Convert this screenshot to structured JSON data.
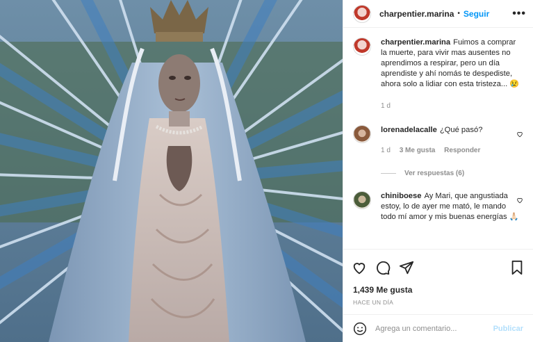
{
  "post": {
    "author": "charpentier.marina",
    "follow_label": "Seguir",
    "separator": "•",
    "more_label": "•••"
  },
  "caption": {
    "username": "charpentier.marina",
    "text": "Fuimos a comprar la muerte, para vivir mas ausentes no aprendimos a respirar, pero un día aprendiste y ahí nomás te despediste, ahora solo a lidiar con esta tristeza... 😢",
    "time": "1 d"
  },
  "comments": [
    {
      "username": "lorenadelacalle",
      "text": "¿Qué pasó?",
      "time": "1 d",
      "likes": "3 Me gusta",
      "reply_label": "Responder",
      "view_replies": "Ver respuestas (6)"
    },
    {
      "username": "chiniboese",
      "text": "Ay Mari, que angustiada estoy, lo de ayer me mató, le mando todo mí amor y mis buenas energías 🙏🏻"
    }
  ],
  "stats": {
    "likes": "1,439 Me gusta",
    "ago": "HACE UN DÍA"
  },
  "add_comment": {
    "placeholder": "Agrega un comentario...",
    "publish_label": "Publicar"
  },
  "icons": [
    "heart-icon",
    "comment-icon",
    "share-icon",
    "bookmark-icon",
    "emoji-icon",
    "more-icon"
  ]
}
